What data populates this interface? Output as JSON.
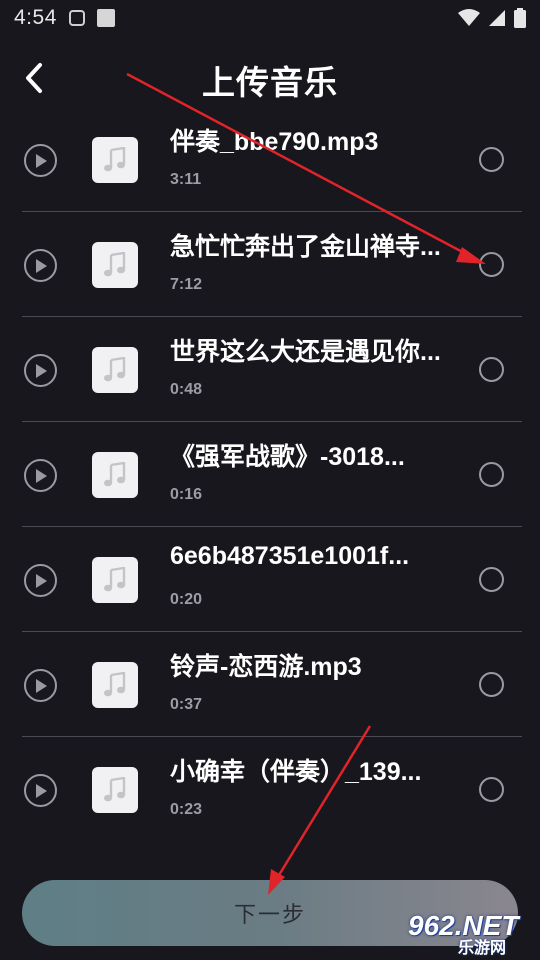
{
  "status_bar": {
    "time": "4:54",
    "icons": [
      "notification-icon",
      "square-icon",
      "wifi-icon",
      "signal-icon",
      "battery-icon"
    ]
  },
  "header": {
    "title": "上传音乐",
    "back_icon": "chevron-left-icon"
  },
  "songs": [
    {
      "title": "伴奏_bbe790.mp3",
      "duration": "3:11",
      "selected": false
    },
    {
      "title": "急忙忙奔出了金山禅寺...",
      "duration": "7:12",
      "selected": false
    },
    {
      "title": "世界这么大还是遇见你...",
      "duration": "0:48",
      "selected": false
    },
    {
      "title": "《强军战歌》-3018...",
      "duration": "0:16",
      "selected": false
    },
    {
      "title": "6e6b487351e1001f...",
      "duration": "0:20",
      "selected": false
    },
    {
      "title": "铃声-恋西游.mp3",
      "duration": "0:37",
      "selected": false
    },
    {
      "title": "小确幸（伴奏）_139...",
      "duration": "0:23",
      "selected": false
    }
  ],
  "footer": {
    "next_label": "下一步"
  },
  "watermark": {
    "main": "962.NET",
    "sub": "乐游网"
  },
  "colors": {
    "background": "#17171d",
    "annotation_arrow": "#e0242a",
    "button_gradient_start": "#5f7e86",
    "button_gradient_end": "#8a868f"
  }
}
